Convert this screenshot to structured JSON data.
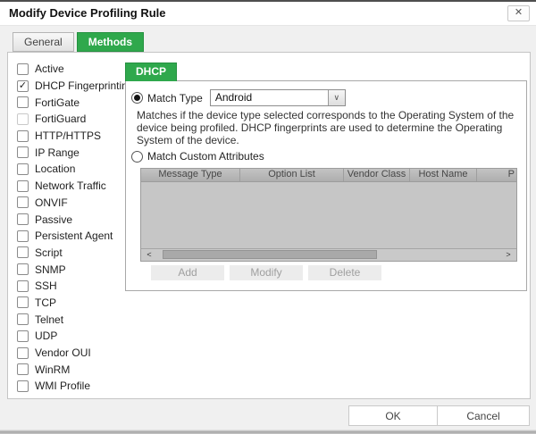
{
  "dialog": {
    "title": "Modify Device Profiling Rule"
  },
  "icons": {
    "close": "✕",
    "checkmark": "✓",
    "chevron_down": "∨",
    "scroll_left": "<",
    "scroll_right": ">"
  },
  "tabs": [
    {
      "label": "General",
      "active": false
    },
    {
      "label": "Methods",
      "active": true
    }
  ],
  "methods": [
    {
      "label": "Active",
      "checked": false,
      "disabled": false
    },
    {
      "label": "DHCP Fingerprinting",
      "checked": true,
      "disabled": false
    },
    {
      "label": "FortiGate",
      "checked": false,
      "disabled": false
    },
    {
      "label": "FortiGuard",
      "checked": false,
      "disabled": true
    },
    {
      "label": "HTTP/HTTPS",
      "checked": false,
      "disabled": false
    },
    {
      "label": "IP Range",
      "checked": false,
      "disabled": false
    },
    {
      "label": "Location",
      "checked": false,
      "disabled": false
    },
    {
      "label": "Network Traffic",
      "checked": false,
      "disabled": false
    },
    {
      "label": "ONVIF",
      "checked": false,
      "disabled": false
    },
    {
      "label": "Passive",
      "checked": false,
      "disabled": false
    },
    {
      "label": "Persistent Agent",
      "checked": false,
      "disabled": false
    },
    {
      "label": "Script",
      "checked": false,
      "disabled": false
    },
    {
      "label": "SNMP",
      "checked": false,
      "disabled": false
    },
    {
      "label": "SSH",
      "checked": false,
      "disabled": false
    },
    {
      "label": "TCP",
      "checked": false,
      "disabled": false
    },
    {
      "label": "Telnet",
      "checked": false,
      "disabled": false
    },
    {
      "label": "UDP",
      "checked": false,
      "disabled": false
    },
    {
      "label": "Vendor OUI",
      "checked": false,
      "disabled": false
    },
    {
      "label": "WinRM",
      "checked": false,
      "disabled": false
    },
    {
      "label": "WMI Profile",
      "checked": false,
      "disabled": false
    }
  ],
  "dhcp_panel": {
    "tab_label": "DHCP",
    "match_type": {
      "selected": true,
      "label": "Match Type",
      "value": "Android"
    },
    "description": "Matches if the device type selected corresponds to the Operating System of the device being profiled. DHCP fingerprints are used to determine the Operating System of the device.",
    "match_custom": {
      "selected": false,
      "label": "Match Custom Attributes"
    },
    "table": {
      "columns": [
        "Message Type",
        "Option List",
        "Vendor Class",
        "Host Name",
        "P"
      ],
      "rows": []
    },
    "actions": [
      {
        "label": "Add",
        "enabled": false
      },
      {
        "label": "Modify",
        "enabled": false
      },
      {
        "label": "Delete",
        "enabled": false
      }
    ]
  },
  "footer": {
    "ok_label": "OK",
    "cancel_label": "Cancel"
  },
  "colors": {
    "accent_green": "#2fa84c",
    "dialog_bg": "#f0f0f0",
    "table_gray": "#c6c6c6"
  }
}
